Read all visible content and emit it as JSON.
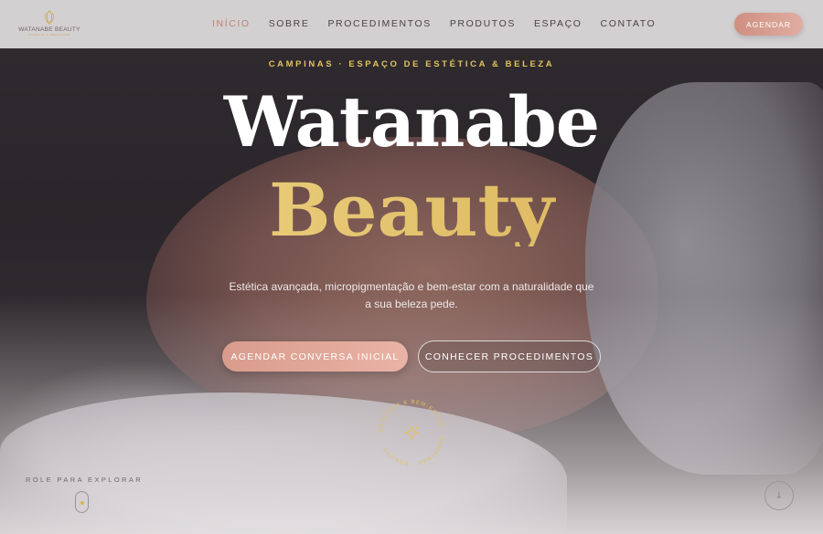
{
  "brand": {
    "name": "WATANABE BEAUTY",
    "tagline": "ESTÉTICA & BEM-ESTAR"
  },
  "nav": {
    "items": [
      {
        "label": "INÍCIO",
        "active": true
      },
      {
        "label": "SOBRE",
        "active": false
      },
      {
        "label": "PROCEDIMENTOS",
        "active": false
      },
      {
        "label": "PRODUTOS",
        "active": false
      },
      {
        "label": "ESPAÇO",
        "active": false
      },
      {
        "label": "CONTATO",
        "active": false
      }
    ],
    "cta_label": "AGENDAR"
  },
  "hero": {
    "eyebrow": "CAMPINAS · ESPAÇO DE ESTÉTICA & BELEZA",
    "title_line1": "Watanabe",
    "title_line2": "Beauty",
    "subtitle": "Estética avançada, micropigmentação e bem-estar com a naturalidade que a sua beleza pede.",
    "primary_cta": "AGENDAR CONVERSA INICIAL",
    "secondary_cta": "CONHECER PROCEDIMENTOS"
  },
  "badge": {
    "ring_text": "ESTÉTICA & BEM-ESTAR · CAMPINAS · BEAUTY ·",
    "icon": "sparkle-icon"
  },
  "scroll": {
    "label": "ROLE PARA EXPLORAR",
    "arrow_icon": "arrow-down-icon"
  },
  "colors": {
    "accent_rose": "#d99c8c",
    "accent_gold": "#e2c15e",
    "nav_active": "#c0826f"
  }
}
